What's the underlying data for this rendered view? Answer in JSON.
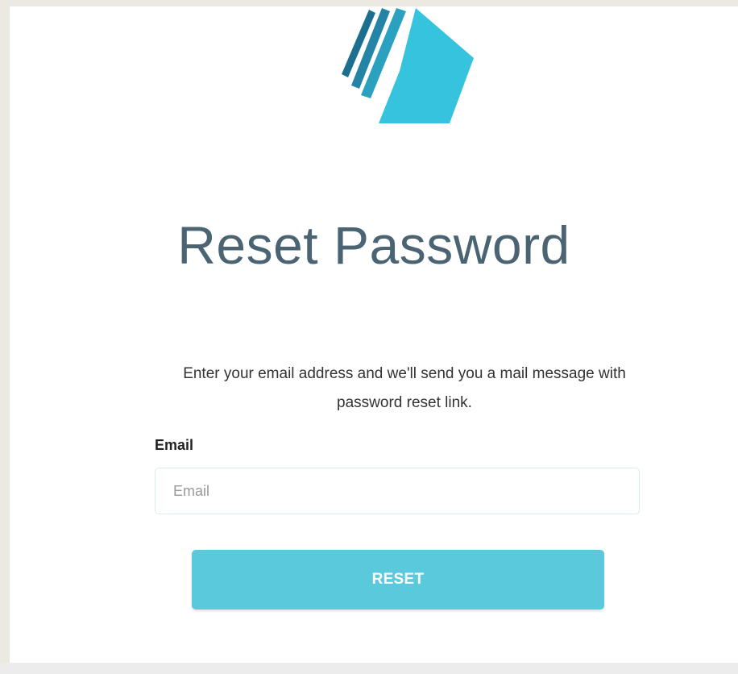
{
  "brand": {
    "logo_icon": "stacked-pages-logo-icon",
    "colors": {
      "stripe_dark": "#1d6f8f",
      "stripe_mid": "#2592b3",
      "stripe_light": "#33b4cf",
      "page_light": "#35c3de"
    }
  },
  "page": {
    "title": "Reset Password",
    "description": "Enter your email address and we'll send you a mail message with password reset link."
  },
  "form": {
    "email_label": "Email",
    "email_placeholder": "Email",
    "email_value": "",
    "reset_button_label": "RESET"
  },
  "theme": {
    "title_color": "#4b6473",
    "button_color": "#5bc9dc",
    "background_color": "#ece9e1"
  }
}
